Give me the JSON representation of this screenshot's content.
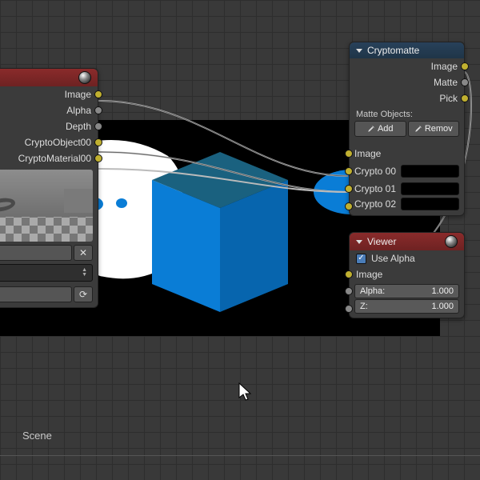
{
  "render_node": {
    "outputs": [
      "Image",
      "Alpha",
      "Depth",
      "CryptoObject00",
      "CryptoMaterial00"
    ]
  },
  "cryptomatte": {
    "title": "Cryptomatte",
    "outputs": [
      "Image",
      "Matte",
      "Pick"
    ],
    "matte_objects_label": "Matte Objects:",
    "add_label": "Add",
    "remove_label": "Remov",
    "inputs": [
      "Image",
      "Crypto 00",
      "Crypto 01",
      "Crypto 02"
    ]
  },
  "viewer": {
    "title": "Viewer",
    "use_alpha_label": "Use Alpha",
    "image_label": "Image",
    "alpha": {
      "label": "Alpha:",
      "value": "1.000"
    },
    "z": {
      "label": "Z:",
      "value": "1.000"
    }
  },
  "footer": {
    "scene": "Scene"
  }
}
